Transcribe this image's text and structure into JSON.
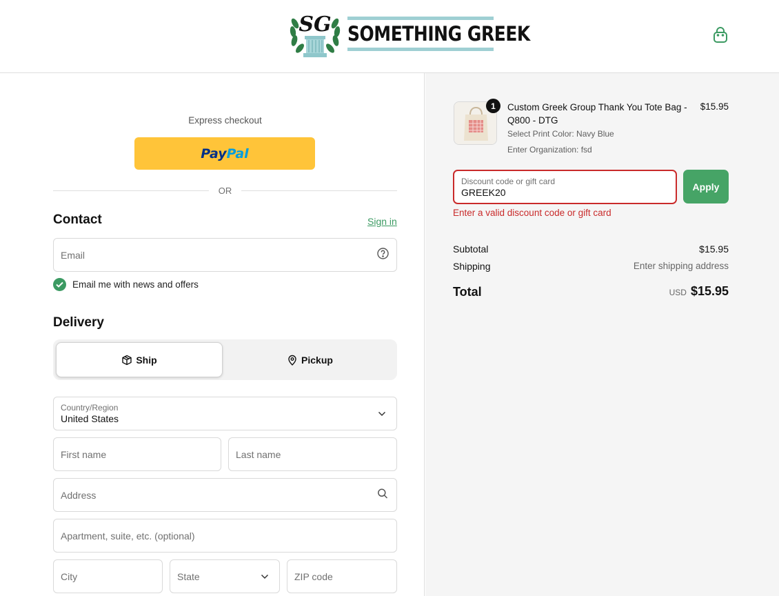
{
  "brand": {
    "monogram": "SG",
    "name": "SOMETHING GREEK",
    "accent_color": "#3b9a62",
    "paypal_color": "#ffc439"
  },
  "header": {
    "cart_icon": "shopping-bag-icon"
  },
  "express": {
    "label": "Express checkout",
    "paypal_part1": "Pay",
    "paypal_part2": "Pal",
    "divider": "OR"
  },
  "contact": {
    "title": "Contact",
    "signin": "Sign in",
    "email_placeholder": "Email",
    "newsletter_label": "Email me with news and offers",
    "newsletter_checked": true
  },
  "delivery": {
    "title": "Delivery",
    "ship_label": "Ship",
    "pickup_label": "Pickup",
    "selected": "Ship",
    "country_label": "Country/Region",
    "country_value": "United States",
    "first_name": "First name",
    "last_name": "Last name",
    "address": "Address",
    "apartment": "Apartment, suite, etc. (optional)",
    "city": "City",
    "state": "State",
    "zip": "ZIP code"
  },
  "cart": {
    "item": {
      "quantity": "1",
      "name": "Custom Greek Group Thank You Tote Bag - Q800 - DTG",
      "meta1": "Select Print Color: Navy Blue",
      "meta2": "Enter Organization: fsd",
      "price": "$15.95"
    },
    "discount": {
      "label": "Discount code or gift card",
      "value": "GREEK20",
      "apply": "Apply",
      "error": "Enter a valid discount code or gift card",
      "error_color": "#c92a2a"
    },
    "summary": {
      "subtotal_label": "Subtotal",
      "subtotal_value": "$15.95",
      "shipping_label": "Shipping",
      "shipping_value": "Enter shipping address",
      "total_label": "Total",
      "currency": "USD",
      "total_value": "$15.95"
    }
  }
}
